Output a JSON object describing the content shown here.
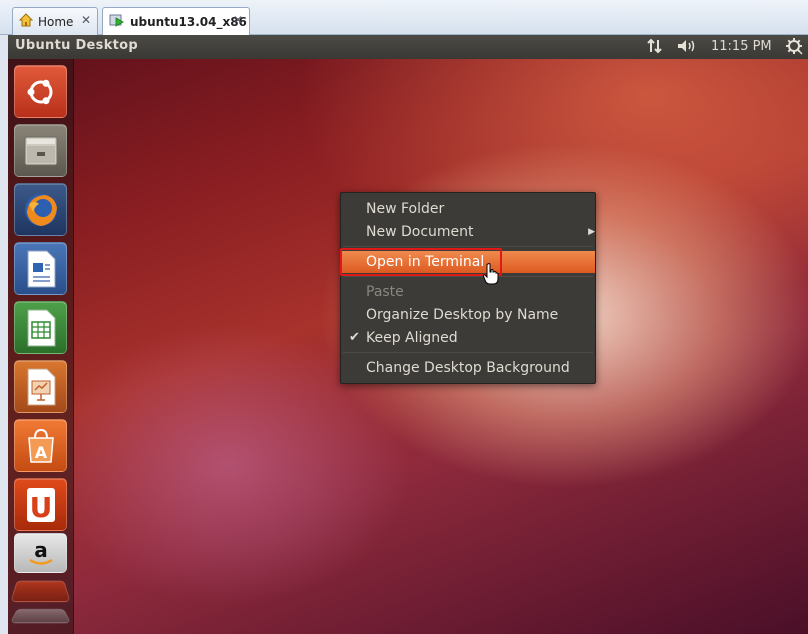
{
  "tabs": [
    {
      "label": "Home"
    },
    {
      "label": "ubuntu13.04_x86"
    }
  ],
  "topbar": {
    "title": "Ubuntu Desktop",
    "clock": "11:15 PM"
  },
  "launcher": [
    {
      "icon": "dash-home-icon"
    },
    {
      "icon": "files-icon"
    },
    {
      "icon": "firefox-icon"
    },
    {
      "icon": "libreoffice-writer-icon"
    },
    {
      "icon": "libreoffice-calc-icon"
    },
    {
      "icon": "libreoffice-impress-icon"
    },
    {
      "icon": "software-center-icon"
    },
    {
      "icon": "ubuntu-one-icon"
    },
    {
      "icon": "amazon-icon"
    }
  ],
  "context_menu": {
    "items": [
      {
        "label": "New Folder"
      },
      {
        "label": "New Document"
      },
      {
        "label": "Open in Terminal"
      },
      {
        "label": "Paste"
      },
      {
        "label": "Organize Desktop by Name"
      },
      {
        "label": "Keep Aligned"
      },
      {
        "label": "Change Desktop Background"
      }
    ]
  },
  "colors": {
    "menu_highlight": "#e8703a",
    "annotation_box": "#e01818"
  }
}
